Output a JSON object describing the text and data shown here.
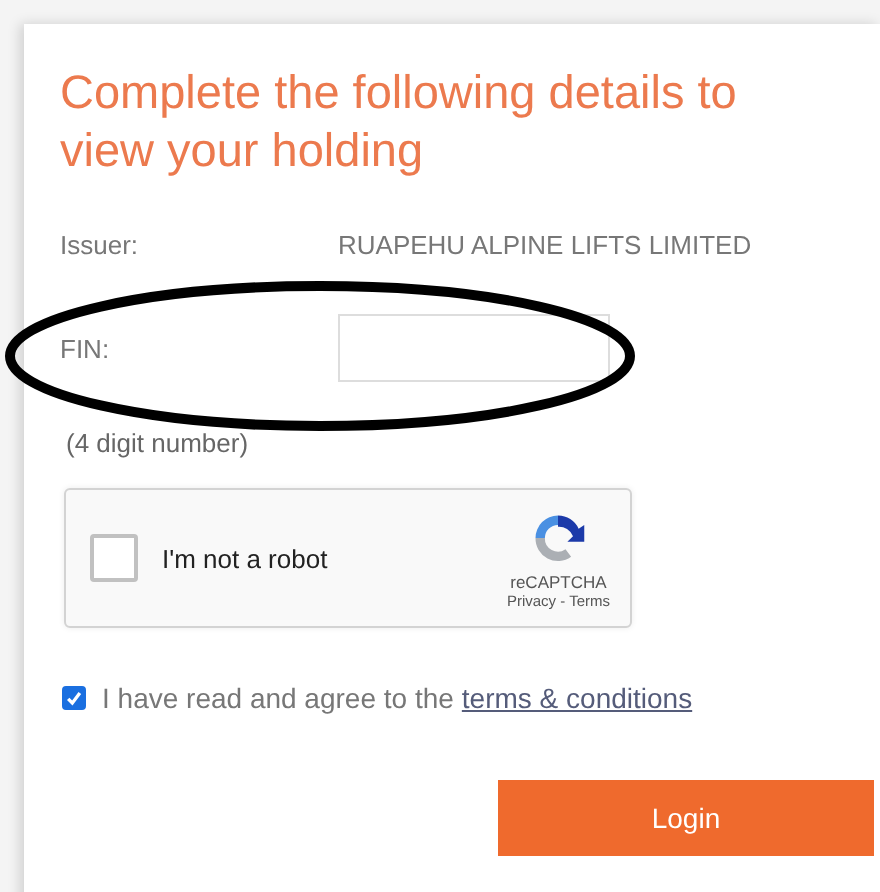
{
  "title": "Complete the following details to view your holding",
  "fields": [
    {
      "kind": "static",
      "label": "Issuer:",
      "value": "RUAPEHU ALPINE LIFTS LIMITED"
    },
    {
      "kind": "input",
      "label": "FIN:"
    }
  ],
  "hint": "(4 digit number)",
  "captcha": {
    "label": "I'm not a robot",
    "checked": false,
    "brand": "reCAPTCHA",
    "privacy": "Privacy",
    "separator": "-",
    "terms": "Terms"
  },
  "agree": {
    "text": "I have read and agree to the",
    "link": "terms & conditions",
    "checked": true
  },
  "button": "Login"
}
